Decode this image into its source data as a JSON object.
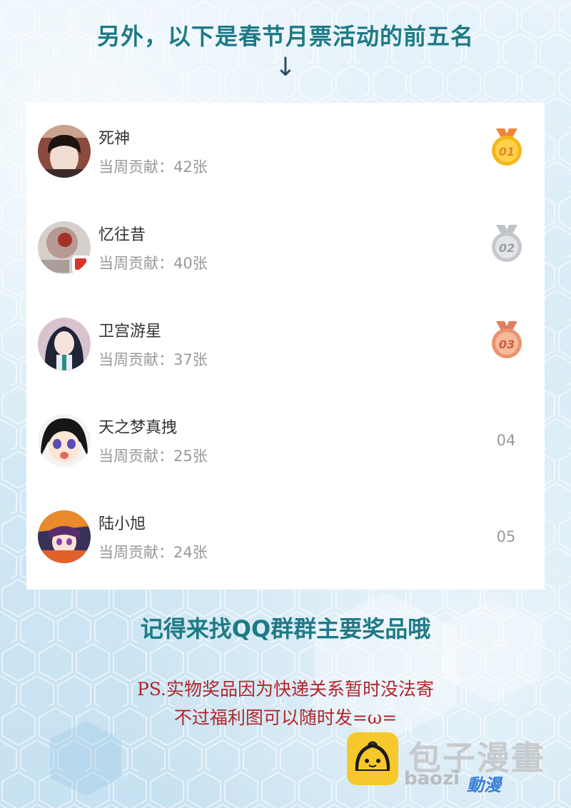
{
  "heading": "另外，以下是春节月票活动的前五名",
  "arrow": "↓",
  "rankings": [
    {
      "name": "死神",
      "contribution": "当周贡献：42张",
      "medal": "01",
      "medal_color": "#f5b61a"
    },
    {
      "name": "忆往昔",
      "contribution": "当周贡献：40张",
      "medal": "02",
      "medal_color": "#c4c8cc"
    },
    {
      "name": "卫宫游星",
      "contribution": "当周贡献：37张",
      "medal": "03",
      "medal_color": "#e9936e"
    },
    {
      "name": "天之梦真拽",
      "contribution": "当周贡献：25张",
      "rank": "04"
    },
    {
      "name": "陆小旭",
      "contribution": "当周贡献：24张",
      "rank": "05"
    }
  ],
  "sub_heading": "记得来找QQ群群主要奖品哦",
  "ps_line1": "PS.实物奖品因为快递关系暂时没法寄",
  "ps_line2": "不过福利图可以随时发=ω=",
  "watermark": {
    "main": "包子漫畫",
    "url": "baozi",
    "tag": "動漫"
  },
  "colors": {
    "heading": "#1e7a86",
    "ps_text": "#b0262a",
    "card": "#ffffff"
  }
}
